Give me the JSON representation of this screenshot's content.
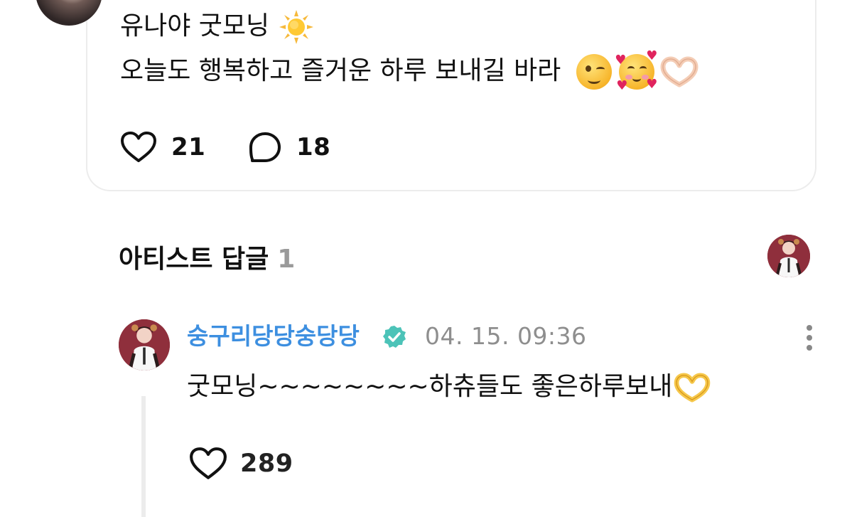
{
  "post": {
    "line1": "유나야 굿모닝",
    "line1_emoji": "sun",
    "line2": "오늘도 행복하고 즐거운 하루 보내길 바라",
    "line2_emojis": [
      "winking-face",
      "smiling-face-with-hearts",
      "heart-hands"
    ],
    "likes": "21",
    "comments": "18"
  },
  "artist_replies": {
    "title": "아티스트 답글",
    "count": "1"
  },
  "reply": {
    "author": "숭구리당당숭당당",
    "timestamp": "04. 15. 09:36",
    "text": "굿모닝~~~~~~~~하츄들도 좋은하루보내",
    "text_emoji": "heart-hands",
    "likes": "289"
  },
  "colors": {
    "author": "#3d8fe0",
    "verified": "#4cc3b8",
    "muted": "#8e8e8e",
    "card_border": "#ececec"
  }
}
